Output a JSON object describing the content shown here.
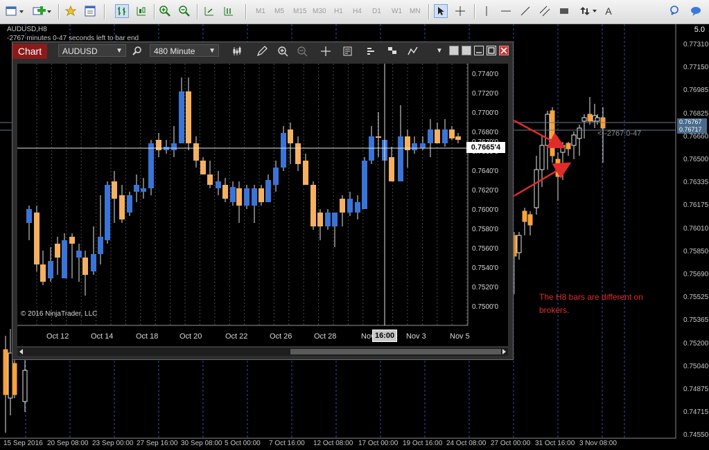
{
  "toolbar": {
    "timeframes": [
      "M1",
      "M5",
      "M15",
      "M30",
      "H1",
      "H4",
      "D1",
      "W1",
      "MN"
    ],
    "text_tool": "A"
  },
  "mt4": {
    "title": "AUDUSD,H8",
    "info": "-2767 minutes 0-47 seconds left to bar end",
    "scale_label": "5.0",
    "price_labels": [
      "0.77310",
      "0.77150",
      "0.76985",
      "0.76825",
      "0.76660",
      "0.76500",
      "0.76335",
      "0.76175",
      "0.76010",
      "0.75850",
      "0.75690",
      "0.75525",
      "0.75365",
      "0.75200",
      "0.75040",
      "0.74875",
      "0.74715",
      "0.74550"
    ],
    "bid_badge": "0.76767",
    "ask_badge": "0.76717",
    "timer_text": "-2767:0-47",
    "time_labels": [
      "15 Sep 2016",
      "20 Sep 08:00",
      "23 Sep 00:00",
      "27 Sep 16:00",
      "30 Sep 08:00",
      "5 Oct 00:00",
      "7 Oct 16:00",
      "12 Oct 08:00",
      "17 Oct 00:00",
      "19 Oct 16:00",
      "24 Oct 08:00",
      "27 Oct 00:00",
      "31 Oct 16:00",
      "3 Nov 08:00"
    ],
    "note": "The H8 bars are different on brokers.",
    "colors": {
      "bull": "#3a74d6",
      "bear": "#f7a23c",
      "grid": "#2a4fb4",
      "annotation": "#e12b2b"
    }
  },
  "nt": {
    "tab_label": "Chart",
    "instrument": "AUDUSD",
    "interval": "480 Minute",
    "price_labels": [
      "0.7740'0",
      "0.7720'0",
      "0.7700'0",
      "0.7680'0",
      "0.7670'0",
      "0.7660'0",
      "0.7640'0",
      "0.7620'0",
      "0.7600'0",
      "0.7580'0",
      "0.7560'0",
      "0.7540'0",
      "0.7520'0",
      "0.7500'0"
    ],
    "current_price": "0.7665'4",
    "date_labels": [
      "Oct 12",
      "Oct 14",
      "Oct 18",
      "Oct 20",
      "Oct 22",
      "Oct 26",
      "Oct 28",
      "Nov",
      "Nov 3",
      "Nov 5"
    ],
    "crosshair_time": "16:00",
    "copyright": "© 2016 NinjaTrader, LLC",
    "colors": {
      "bull": "#3a74d6",
      "bear": "#f5b060"
    }
  }
}
